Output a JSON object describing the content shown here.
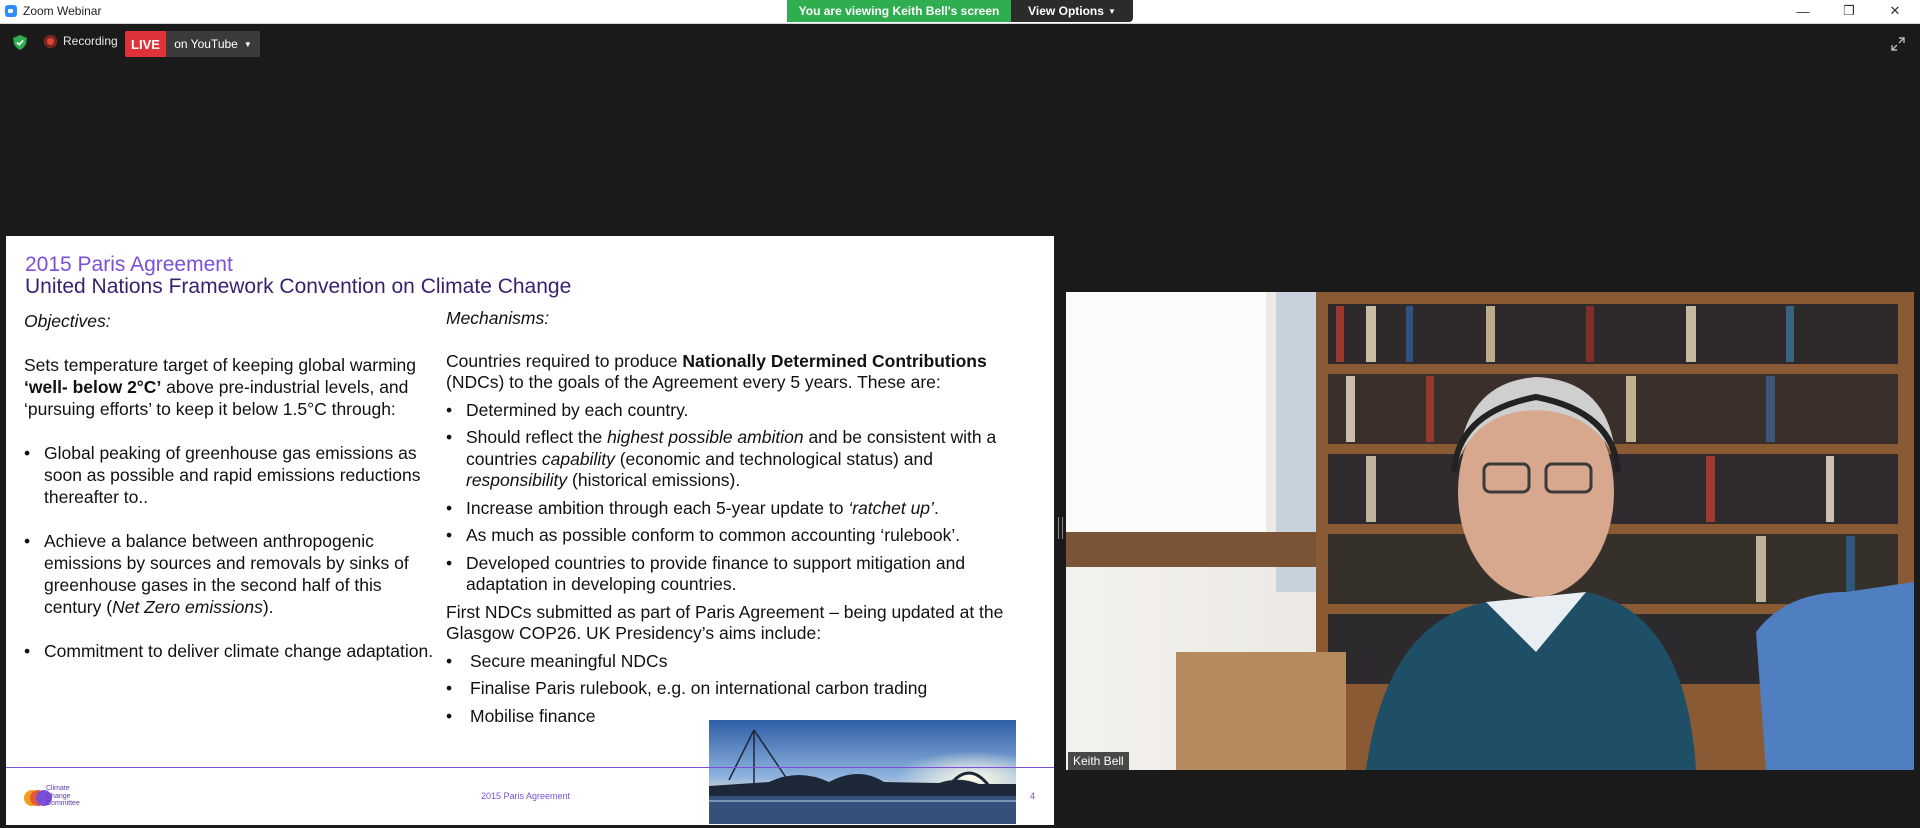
{
  "window": {
    "title": "Zoom Webinar",
    "viewing_banner": "You are viewing Keith Bell's screen",
    "view_options_label": "View Options",
    "minimize_glyph": "—",
    "restore_glyph": "❐",
    "close_glyph": "✕"
  },
  "toolbar": {
    "recording_label": "Recording",
    "live_label": "LIVE",
    "platform_label": "on YouTube"
  },
  "slide": {
    "title_line1": "2015 Paris Agreement",
    "title_line2": "United Nations Framework Convention on Climate Change",
    "objectives": {
      "heading": "Objectives:",
      "intro_a": "Sets temperature target of keeping global warming ",
      "intro_b": "‘well- below 2°C’",
      "intro_c": " above pre-industrial levels, and ‘pursuing efforts’ to keep it below 1.5°C through:",
      "bullet1": "Global peaking of greenhouse gas emissions as soon as possible and rapid emissions reductions thereafter to..",
      "bullet2_a": "Achieve a balance between anthropogenic emissions by sources and removals by sinks of greenhouse gases in the second half of this century (",
      "bullet2_b": "Net Zero emissions",
      "bullet2_c": ").",
      "bullet3": "Commitment to deliver climate change adaptation."
    },
    "mechanisms": {
      "heading": "Mechanisms:",
      "intro_a": "Countries required to produce ",
      "intro_b": "Nationally Determined Contributions",
      "intro_c": " (NDCs) to the goals of the Agreement every 5 years. These are:",
      "b1": "Determined by each country.",
      "b2_a": "Should reflect the ",
      "b2_b": "highest possible ambition",
      "b2_c": " and be consistent with a countries ",
      "b2_d": "capability",
      "b2_e": " (economic and technological status) and ",
      "b2_f": "responsibility",
      "b2_g": " (historical emissions).",
      "b3_a": "Increase ambition through each 5-year update to ",
      "b3_b": "‘ratchet up’",
      "b3_c": ".",
      "b4": "As much as possible conform to common accounting ‘rulebook’.",
      "b5": "Developed countries to provide finance to support mitigation and adaptation in developing countries.",
      "para2": "First NDCs submitted as part of Paris Agreement – being updated at the Glasgow COP26. UK Presidency’s aims include:",
      "c1": "Secure meaningful NDCs",
      "c2": "Finalise Paris rulebook, e.g. on international carbon trading",
      "c3": "Mobilise finance"
    },
    "footer": {
      "logo_line1": "Climate",
      "logo_line2": "Change",
      "logo_line3": "Committee",
      "center": "2015 Paris Agreement",
      "page": "4"
    }
  },
  "video": {
    "participant_name": "Keith Bell"
  },
  "colors": {
    "banner_green": "#2fae50",
    "live_red": "#e0323a",
    "slide_purple": "#7b4fd9",
    "slide_dark_purple": "#3b1f6e",
    "background": "#1a1a1a"
  },
  "icons": [
    "zoom-app-icon",
    "shield-icon",
    "recording-icon",
    "chevron-down-icon",
    "expand-icon",
    "minimize-icon",
    "restore-icon",
    "close-icon"
  ]
}
